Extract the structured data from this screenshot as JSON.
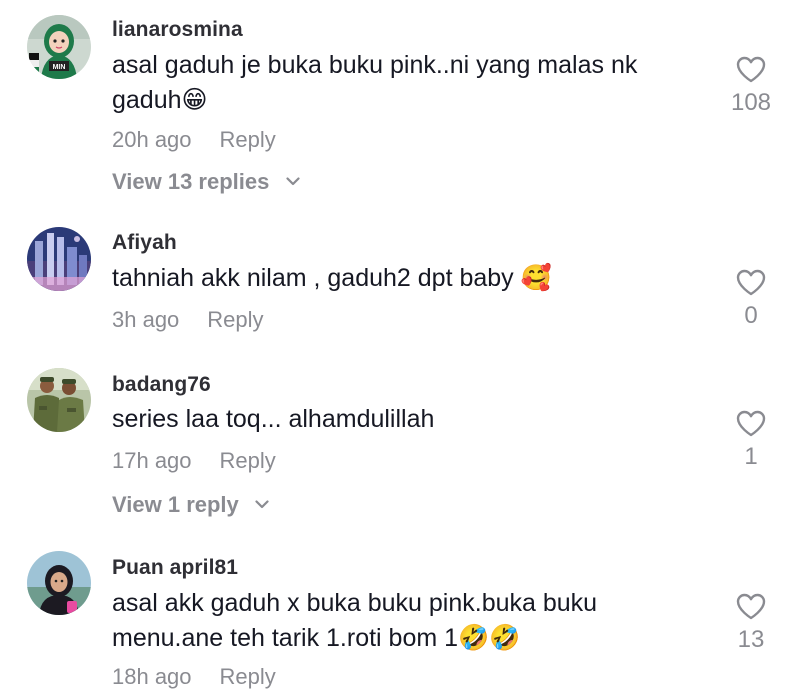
{
  "comments": [
    {
      "username": "lianarosmina",
      "text": "asal gaduh je buka buku pink..ni yang malas nk\ngaduh😁",
      "time": "20h ago",
      "reply_label": "Reply",
      "view_replies": "View 13 replies",
      "likes": "108",
      "avatar": "avatar-girl-green-hijab"
    },
    {
      "username": "Afiyah",
      "text": "tahniah akk nilam , gaduh2 dpt baby 🥰",
      "time": "3h ago",
      "reply_label": "Reply",
      "likes": "0",
      "avatar": "avatar-city-skyline"
    },
    {
      "username": "badang76",
      "text": "series laa toq... alhamdulillah",
      "time": "17h ago",
      "reply_label": "Reply",
      "view_replies": "View 1 reply",
      "likes": "1",
      "avatar": "avatar-soldiers"
    },
    {
      "username": "Puan april81",
      "text": "asal akk gaduh x buka buku pink.buka buku\nmenu.ane teh tarik 1.roti bom 1🤣🤣",
      "time": "18h ago",
      "reply_label": "Reply",
      "likes": "13",
      "avatar": "avatar-woman-hijab"
    }
  ],
  "avatar_badge_text": "MIN",
  "colors": {
    "text": "#161823",
    "username": "#2f2f35",
    "secondary": "#8a8b91",
    "background": "#ffffff"
  },
  "icons": {
    "like": "heart-outline-icon",
    "expand": "chevron-down-icon"
  }
}
